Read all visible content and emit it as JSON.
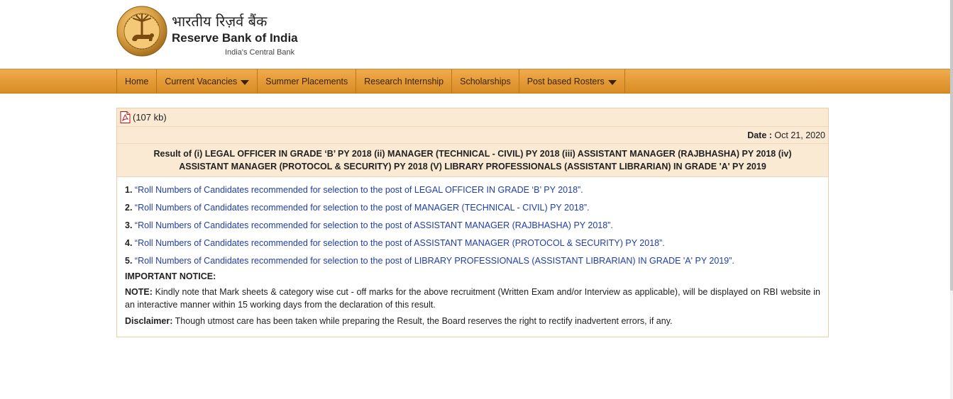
{
  "brand": {
    "hindi_name": "भारतीय रिज़र्व बैंक",
    "english_name": "Reserve Bank of India",
    "tagline": "India's Central Bank",
    "seal_icon": "rbi-seal-icon"
  },
  "nav": {
    "items": [
      {
        "label": "Home",
        "dropdown": false
      },
      {
        "label": "Current Vacancies",
        "dropdown": true
      },
      {
        "label": "Summer Placements",
        "dropdown": false
      },
      {
        "label": "Research Internship",
        "dropdown": false
      },
      {
        "label": "Scholarships",
        "dropdown": false
      },
      {
        "label": "Post based Rosters",
        "dropdown": true
      }
    ]
  },
  "attachment": {
    "icon": "pdf-icon",
    "size": "(107 kb)"
  },
  "date": {
    "label": "Date :",
    "value": "Oct 21, 2020"
  },
  "title": "Result of (i) LEGAL OFFICER IN GRADE ‘B’ PY 2018 (ii) MANAGER (TECHNICAL - CIVIL) PY 2018 (iii) ASSISTANT MANAGER (RAJBHASHA) PY 2018 (iv) ASSISTANT MANAGER (PROTOCOL & SECURITY) PY 2018 (V) LIBRARY PROFESSIONALS (ASSISTANT LIBRARIAN) IN GRADE 'A' PY 2019",
  "results": [
    {
      "num": "1.",
      "link": "“Roll Numbers of Candidates recommended for selection to the post of LEGAL OFFICER IN GRADE ‘B’ PY 2018”."
    },
    {
      "num": "2.",
      "link": "“Roll Numbers of Candidates recommended for selection to the post of MANAGER (TECHNICAL - CIVIL) PY 2018”."
    },
    {
      "num": "3.",
      "link": "“Roll Numbers of Candidates recommended for selection to the post of ASSISTANT MANAGER (RAJBHASHA) PY 2018”."
    },
    {
      "num": "4.",
      "link": "“Roll Numbers of Candidates recommended for selection to the post of ASSISTANT MANAGER (PROTOCOL & SECURITY) PY 2018”."
    },
    {
      "num": "5.",
      "link": "“Roll Numbers of Candidates recommended for selection to the post of LIBRARY PROFESSIONALS (ASSISTANT LIBRARIAN) IN GRADE 'A' PY 2019”."
    }
  ],
  "notice": {
    "heading": "IMPORTANT NOTICE:",
    "note_label": "NOTE:",
    "note_text": " Kindly note that Mark sheets & category wise cut - off marks for the above recruitment (Written Exam and/or Interview as applicable), will be displayed on RBI website in an interactive manner within 15 working days from the declaration of this result.",
    "disclaimer_label": "Disclaimer:",
    "disclaimer_text": " Though utmost care has been taken while preparing the Result, the Board reserves the right to rectify inadvertent errors, if any."
  },
  "colors": {
    "nav_bg": "#e39a35",
    "panel_header_bg": "#fae9d3",
    "link": "#1f3ea8"
  }
}
